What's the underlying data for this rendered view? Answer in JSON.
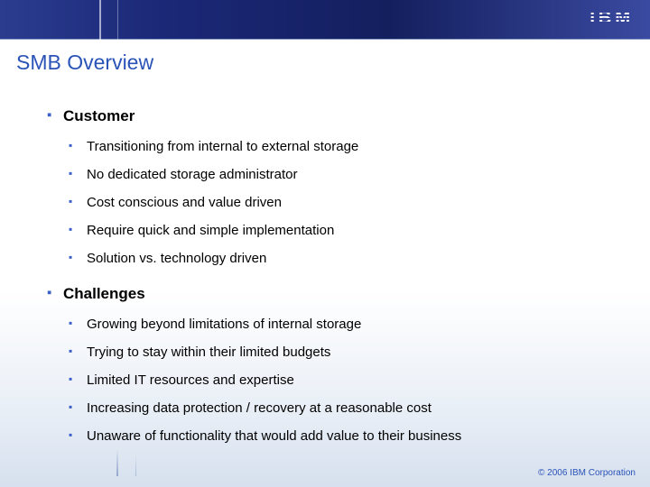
{
  "brand": "IBM",
  "title": "SMB Overview",
  "sections": [
    {
      "heading": "Customer",
      "items": [
        "Transitioning from internal to external storage",
        "No dedicated storage administrator",
        "Cost conscious and value driven",
        "Require quick and simple implementation",
        "Solution vs. technology driven"
      ]
    },
    {
      "heading": "Challenges",
      "items": [
        "Growing beyond limitations of internal storage",
        "Trying to stay within their limited budgets",
        "Limited IT resources and expertise",
        "Increasing data protection / recovery at a reasonable cost",
        "Unaware of functionality that would add value to their business"
      ]
    }
  ],
  "footer": "© 2006 IBM Corporation"
}
